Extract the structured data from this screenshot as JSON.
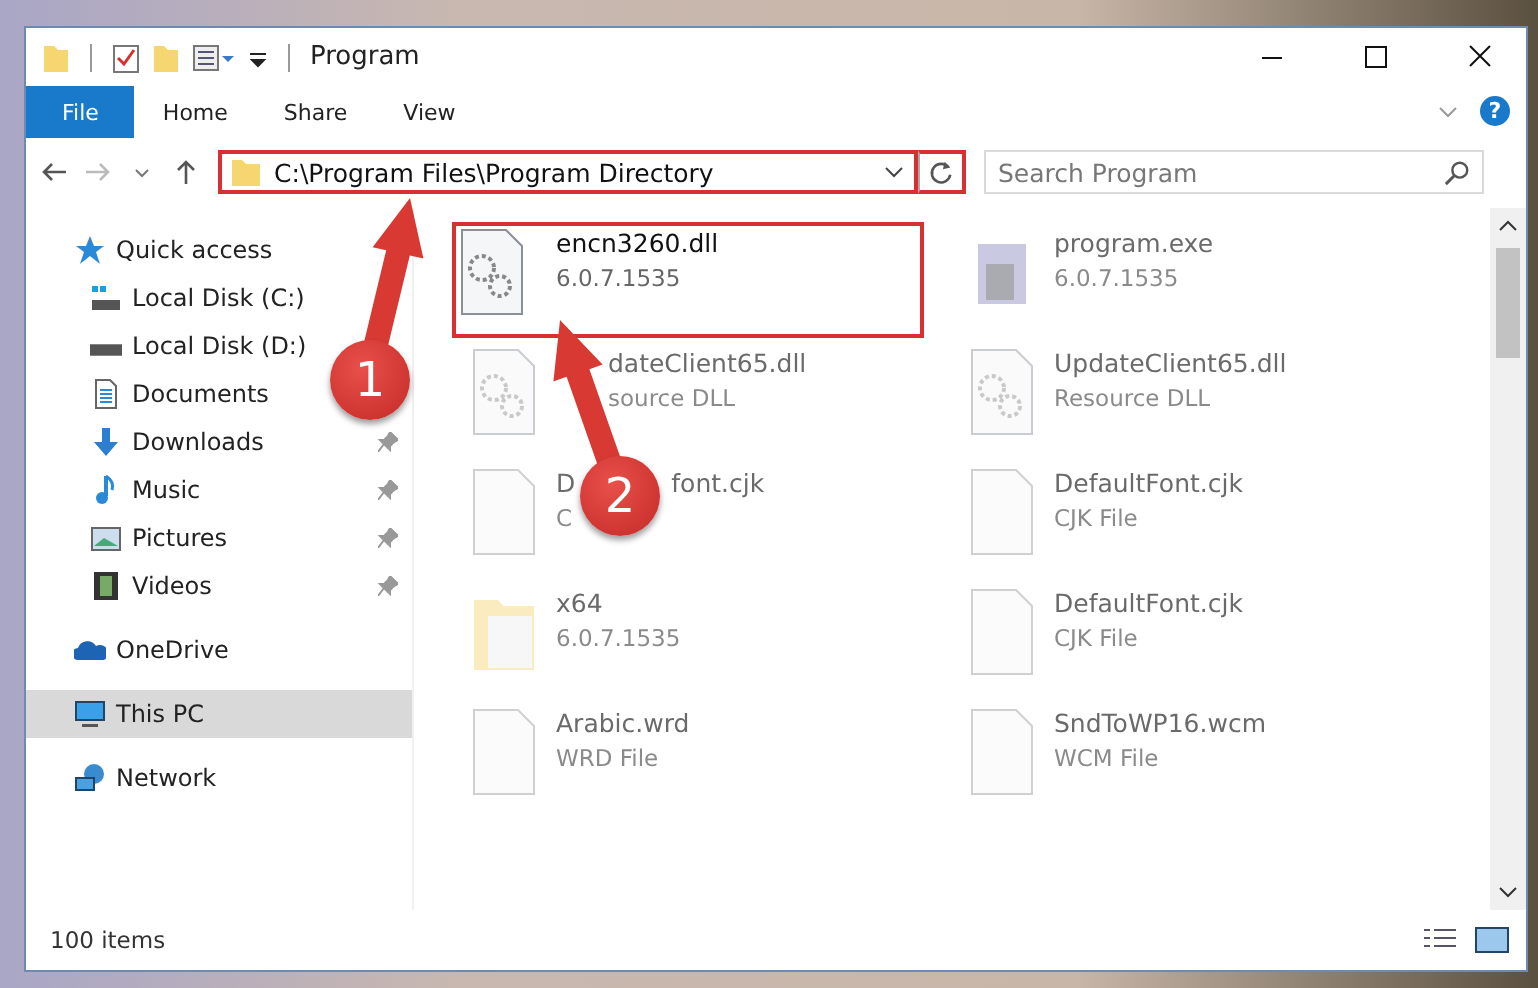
{
  "window": {
    "title": "Program"
  },
  "ribbon": {
    "tabs": [
      {
        "label": "File",
        "selected": true
      },
      {
        "label": "Home",
        "selected": false
      },
      {
        "label": "Share",
        "selected": false
      },
      {
        "label": "View",
        "selected": false
      }
    ],
    "help": "?"
  },
  "address": {
    "path": "C:\\Program Files\\Program Directory",
    "highlighted": true
  },
  "search": {
    "placeholder": "Search Program"
  },
  "nav": [
    {
      "label": "Quick access",
      "kind": "star",
      "selected": false,
      "children": [
        {
          "label": "Local Disk (C:)",
          "kind": "system-drive",
          "pinned": false
        },
        {
          "label": "Local Disk (D:)",
          "kind": "drive",
          "pinned": false
        },
        {
          "label": "Documents",
          "kind": "document",
          "pinned": false
        },
        {
          "label": "Downloads",
          "kind": "download",
          "pinned": true
        },
        {
          "label": "Music",
          "kind": "music",
          "pinned": true
        },
        {
          "label": "Pictures",
          "kind": "picture",
          "pinned": true
        },
        {
          "label": "Videos",
          "kind": "video",
          "pinned": true
        }
      ]
    },
    {
      "label": "OneDrive",
      "kind": "cloud",
      "selected": false
    },
    {
      "label": "This PC",
      "kind": "pc",
      "selected": true
    },
    {
      "label": "Network",
      "kind": "network",
      "selected": false
    }
  ],
  "files": [
    {
      "name": "encn3260.dll",
      "detail": "6.0.7.1535",
      "kind": "gear-file",
      "faded": false,
      "highlighted": true,
      "covered_start": false
    },
    {
      "name": "program.exe",
      "detail": "6.0.7.1535",
      "kind": "installer",
      "faded": true,
      "highlighted": false,
      "covered_start": false
    },
    {
      "name": "dateClient65.dll",
      "detail": "source DLL",
      "kind": "gear-file",
      "faded": true,
      "highlighted": false,
      "covered_start": true
    },
    {
      "name": "UpdateClient65.dll",
      "detail": "Resource DLL",
      "kind": "gear-file",
      "faded": true,
      "highlighted": false,
      "covered_start": false
    },
    {
      "name": "D",
      "name_after_cover": "font.cjk",
      "detail": "C",
      "kind": "blank",
      "faded": true,
      "highlighted": false,
      "covered_start": false
    },
    {
      "name": "DefaultFont.cjk",
      "detail": "CJK File",
      "kind": "blank",
      "faded": true,
      "highlighted": false,
      "covered_start": false
    },
    {
      "name": "x64",
      "detail": "6.0.7.1535",
      "kind": "folder",
      "faded": true,
      "highlighted": false,
      "covered_start": false
    },
    {
      "name": "DefaultFont.cjk",
      "detail": "CJK File",
      "kind": "blank",
      "faded": true,
      "highlighted": false,
      "covered_start": false
    },
    {
      "name": "Arabic.wrd",
      "detail": "WRD File",
      "kind": "blank",
      "faded": true,
      "highlighted": false,
      "covered_start": false
    },
    {
      "name": "SndToWP16.wcm",
      "detail": "WCM File",
      "kind": "blank",
      "faded": true,
      "highlighted": false,
      "covered_start": false
    }
  ],
  "status_bar": {
    "count": "100 items"
  },
  "callouts": [
    {
      "number": "1"
    },
    {
      "number": "2"
    }
  ]
}
